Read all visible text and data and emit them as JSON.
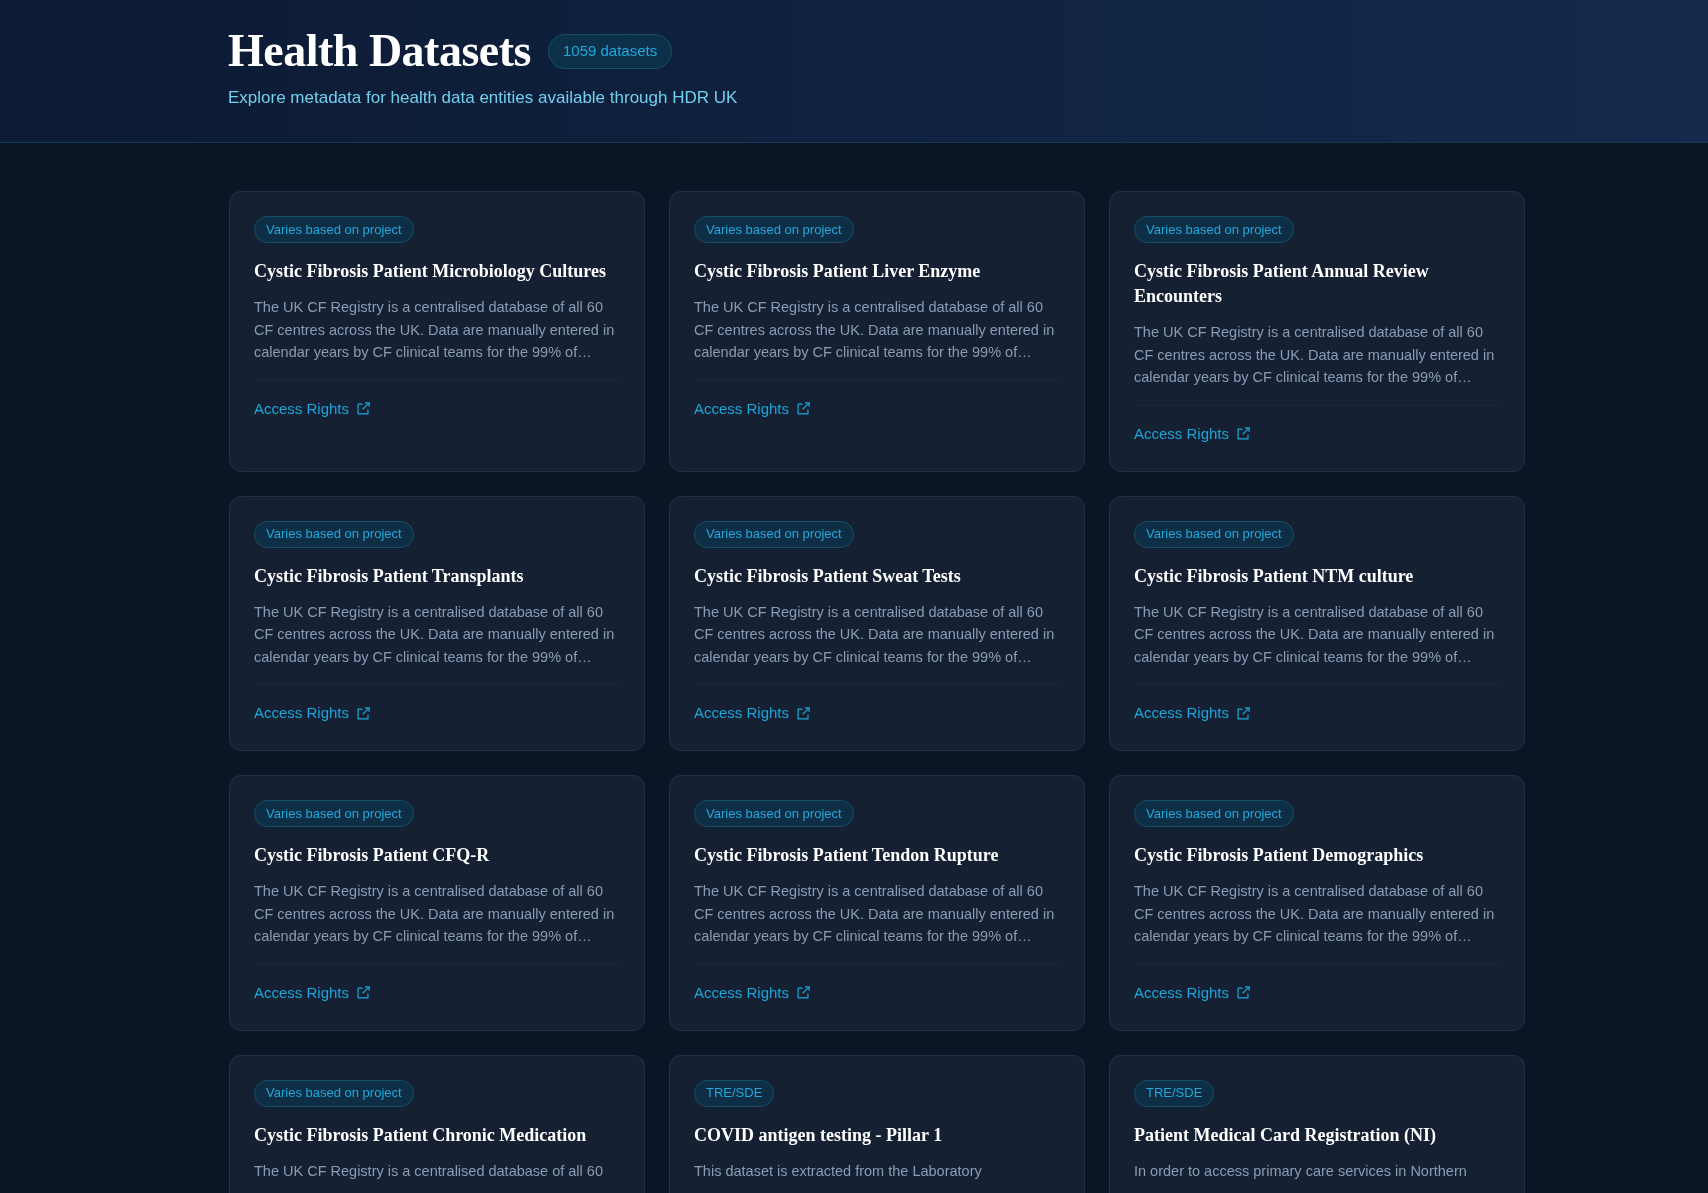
{
  "header": {
    "title": "Health Datasets",
    "count_badge": "1059 datasets",
    "subtitle": "Explore metadata for health data entities available through HDR UK"
  },
  "datasets": [
    {
      "access_tag": "Varies based on project",
      "title": "Cystic Fibrosis Patient Microbiology Cultures",
      "description": "The UK CF Registry is a centralised database of all 60 CF centres across the UK. Data are manually entered in calendar years by CF clinical teams for the 99% of…",
      "link": "Access Rights"
    },
    {
      "access_tag": "Varies based on project",
      "title": "Cystic Fibrosis Patient Liver Enzyme",
      "description": "The UK CF Registry is a centralised database of all 60 CF centres across the UK. Data are manually entered in calendar years by CF clinical teams for the 99% of…",
      "link": "Access Rights"
    },
    {
      "access_tag": "Varies based on project",
      "title": "Cystic Fibrosis Patient Annual Review Encounters",
      "description": "The UK CF Registry is a centralised database of all 60 CF centres across the UK. Data are manually entered in calendar years by CF clinical teams for the 99% of…",
      "link": "Access Rights"
    },
    {
      "access_tag": "Varies based on project",
      "title": "Cystic Fibrosis Patient Transplants",
      "description": "The UK CF Registry is a centralised database of all 60 CF centres across the UK. Data are manually entered in calendar years by CF clinical teams for the 99% of…",
      "link": "Access Rights"
    },
    {
      "access_tag": "Varies based on project",
      "title": "Cystic Fibrosis Patient Sweat Tests",
      "description": "The UK CF Registry is a centralised database of all 60 CF centres across the UK. Data are manually entered in calendar years by CF clinical teams for the 99% of…",
      "link": "Access Rights"
    },
    {
      "access_tag": "Varies based on project",
      "title": "Cystic Fibrosis Patient NTM culture",
      "description": "The UK CF Registry is a centralised database of all 60 CF centres across the UK. Data are manually entered in calendar years by CF clinical teams for the 99% of…",
      "link": "Access Rights"
    },
    {
      "access_tag": "Varies based on project",
      "title": "Cystic Fibrosis Patient CFQ-R",
      "description": "The UK CF Registry is a centralised database of all 60 CF centres across the UK. Data are manually entered in calendar years by CF clinical teams for the 99% of…",
      "link": "Access Rights"
    },
    {
      "access_tag": "Varies based on project",
      "title": "Cystic Fibrosis Patient Tendon Rupture",
      "description": "The UK CF Registry is a centralised database of all 60 CF centres across the UK. Data are manually entered in calendar years by CF clinical teams for the 99% of…",
      "link": "Access Rights"
    },
    {
      "access_tag": "Varies based on project",
      "title": "Cystic Fibrosis Patient Demographics",
      "description": "The UK CF Registry is a centralised database of all 60 CF centres across the UK. Data are manually entered in calendar years by CF clinical teams for the 99% of…",
      "link": "Access Rights"
    },
    {
      "access_tag": "Varies based on project",
      "title": "Cystic Fibrosis Patient Chronic Medication",
      "description": "The UK CF Registry is a centralised database of all 60"
    },
    {
      "access_tag": "TRE/SDE",
      "title": "COVID antigen testing - Pillar 1",
      "description": "This dataset is extracted from the Laboratory"
    },
    {
      "access_tag": "TRE/SDE",
      "title": "Patient Medical Card Registration (NI)",
      "description": "In order to access primary care services in Northern"
    }
  ]
}
